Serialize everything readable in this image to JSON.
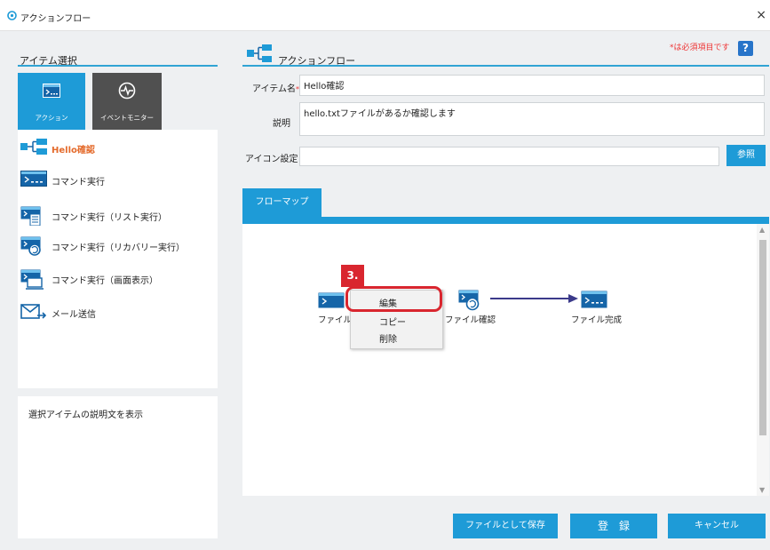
{
  "window": {
    "title": "アクションフロー",
    "close_glyph": "×"
  },
  "left_panel": {
    "heading": "アイテム選択",
    "tabs": [
      {
        "label": "アクション",
        "icon": "command-icon"
      },
      {
        "label": "イベントモニター",
        "icon": "monitor-icon"
      }
    ],
    "items": [
      {
        "label": "Hello確認",
        "icon": "flow-icon",
        "highlighted": true
      },
      {
        "label": "コマンド実行",
        "icon": "command-icon"
      },
      {
        "label": "コマンド実行（リスト実行）",
        "icon": "command-list-icon"
      },
      {
        "label": "コマンド実行（リカバリー実行）",
        "icon": "command-recovery-icon"
      },
      {
        "label": "コマンド実行（画面表示）",
        "icon": "command-screen-icon"
      },
      {
        "label": "メール送信",
        "icon": "mail-icon"
      }
    ],
    "description": "選択アイテムの説明文を表示"
  },
  "right_panel": {
    "heading": "アクションフロー",
    "required_note": "*は必須項目です",
    "help_glyph": "?",
    "item_name_label": "アイテム名",
    "item_name_required": "*",
    "item_name_value": "Hello確認",
    "description_label": "説明",
    "description_value": "hello.txtファイルがあるか確認します",
    "icon_label": "アイコン設定",
    "icon_value": "",
    "browse_button": "参照",
    "flow_tab": "フローマップ"
  },
  "flow_nodes": [
    {
      "label": "ファイルイ",
      "icon": "command-icon"
    },
    {
      "label": "ファイル確認",
      "icon": "command-recovery-icon"
    },
    {
      "label": "ファイル完成",
      "icon": "command-icon"
    }
  ],
  "context_menu": {
    "items": [
      "編集",
      "コピー",
      "削除"
    ],
    "step_badge": "3."
  },
  "buttons": {
    "save_file": "ファイルとして保存",
    "register": "登　録",
    "cancel": "キャンセル"
  },
  "colors": {
    "accent": "#1e9bd7",
    "highlight": "#d9262f",
    "tab_inactive": "#505050"
  }
}
